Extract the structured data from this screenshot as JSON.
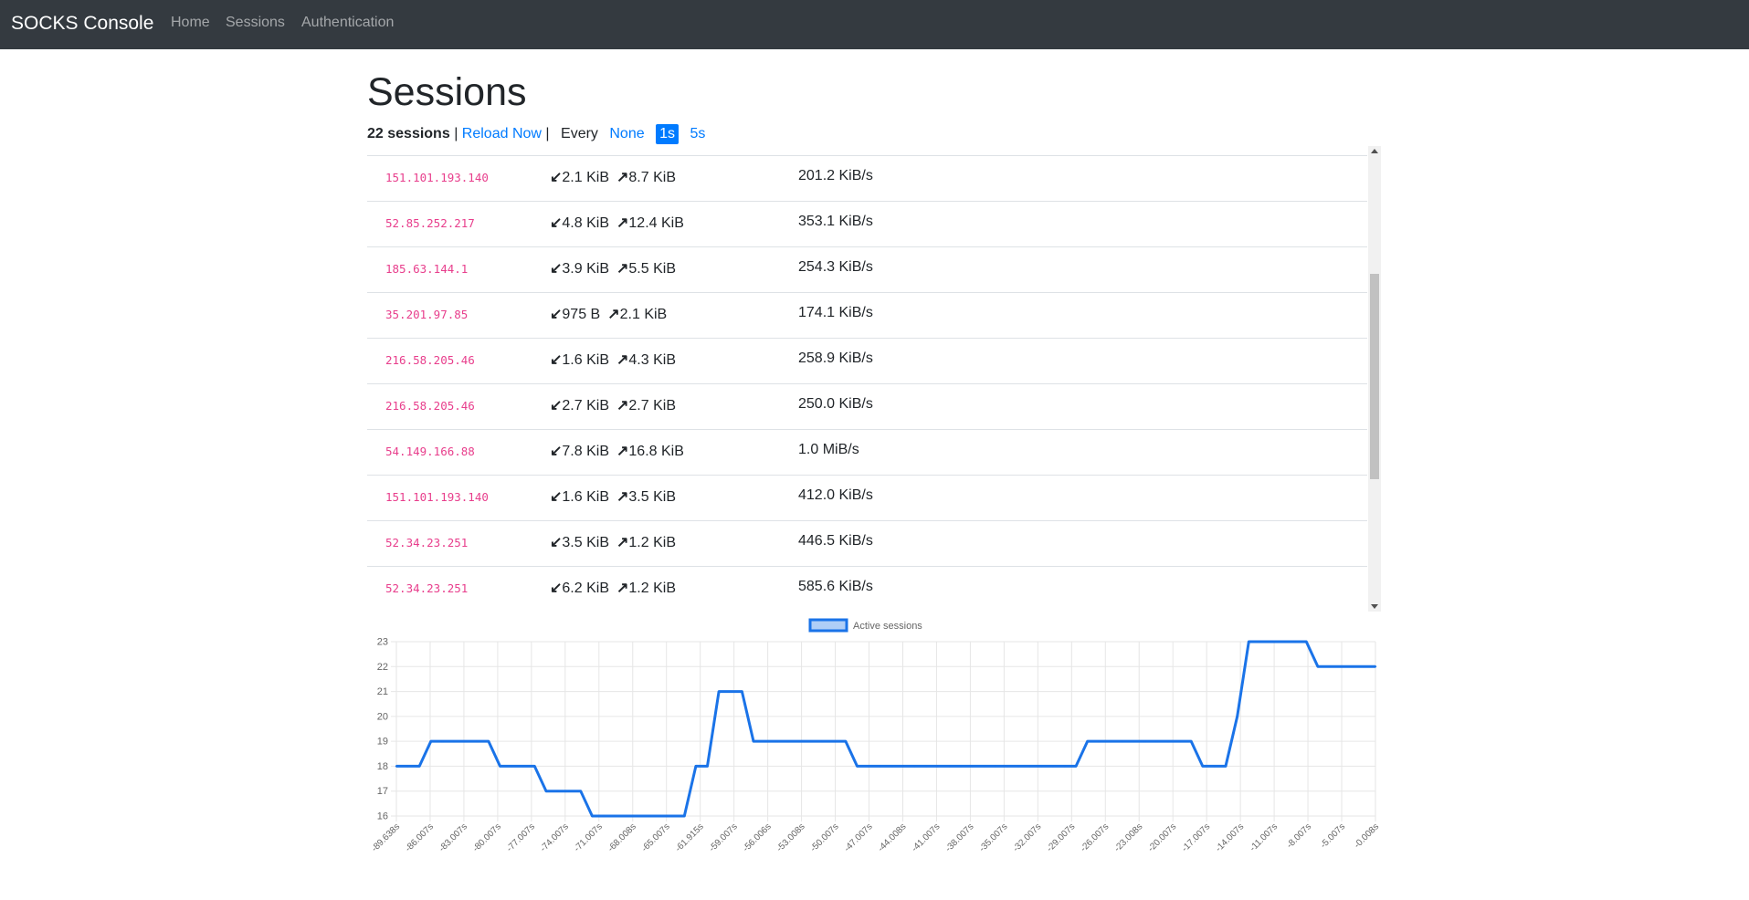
{
  "app": {
    "brand": "SOCKS Console",
    "nav": [
      "Home",
      "Sessions",
      "Authentication"
    ]
  },
  "page": {
    "title": "Sessions",
    "session_count": "22 sessions",
    "sep1": "|",
    "reload": "Reload Now",
    "sep2": "|",
    "every": "Every",
    "options": [
      "None",
      "1s",
      "5s"
    ],
    "selected_option": "1s"
  },
  "icons": {
    "download": "arrow-down-left-icon",
    "upload": "arrow-up-right-icon"
  },
  "colors": {
    "accent": "#007bff",
    "ip_text": "#e83e8c",
    "navbar": "#343a40",
    "series": "#1a73e8"
  },
  "sessions": [
    {
      "ip": "151.101.193.140",
      "down": "2.1 KiB",
      "up": "8.7 KiB",
      "rate": "201.2 KiB/s"
    },
    {
      "ip": "52.85.252.217",
      "down": "4.8 KiB",
      "up": "12.4 KiB",
      "rate": "353.1 KiB/s"
    },
    {
      "ip": "185.63.144.1",
      "down": "3.9 KiB",
      "up": "5.5 KiB",
      "rate": "254.3 KiB/s"
    },
    {
      "ip": "35.201.97.85",
      "down": "975 B",
      "up": "2.1 KiB",
      "rate": "174.1 KiB/s"
    },
    {
      "ip": "216.58.205.46",
      "down": "1.6 KiB",
      "up": "4.3 KiB",
      "rate": "258.9 KiB/s"
    },
    {
      "ip": "216.58.205.46",
      "down": "2.7 KiB",
      "up": "2.7 KiB",
      "rate": "250.0 KiB/s"
    },
    {
      "ip": "54.149.166.88",
      "down": "7.8 KiB",
      "up": "16.8 KiB",
      "rate": "1.0 MiB/s"
    },
    {
      "ip": "151.101.193.140",
      "down": "1.6 KiB",
      "up": "3.5 KiB",
      "rate": "412.0 KiB/s"
    },
    {
      "ip": "52.34.23.251",
      "down": "3.5 KiB",
      "up": "1.2 KiB",
      "rate": "446.5 KiB/s"
    },
    {
      "ip": "52.34.23.251",
      "down": "6.2 KiB",
      "up": "1.2 KiB",
      "rate": "585.6 KiB/s"
    }
  ],
  "chart_data": {
    "type": "line",
    "legend": [
      "Active sessions"
    ],
    "legend_position": "top-center",
    "grid": true,
    "ylim": [
      16,
      23
    ],
    "y_ticks": [
      16,
      17,
      18,
      19,
      20,
      21,
      22,
      23
    ],
    "x_tick_labels": [
      "-89.638s",
      "-86.007s",
      "-83.007s",
      "-80.007s",
      "-77.007s",
      "-74.007s",
      "-71.007s",
      "-68.008s",
      "-65.007s",
      "-61.915s",
      "-59.007s",
      "-56.006s",
      "-53.008s",
      "-50.007s",
      "-47.007s",
      "-44.008s",
      "-41.007s",
      "-38.007s",
      "-35.007s",
      "-32.007s",
      "-29.007s",
      "-26.007s",
      "-23.008s",
      "-20.007s",
      "-17.007s",
      "-14.007s",
      "-11.007s",
      "-8.007s",
      "-5.007s",
      "-0.008s"
    ],
    "series": [
      {
        "name": "Active sessions",
        "values": [
          18,
          18,
          18,
          19,
          19,
          19,
          19,
          19,
          19,
          18,
          18,
          18,
          18,
          17,
          17,
          17,
          17,
          16,
          16,
          16,
          16,
          16,
          16,
          16,
          16,
          16,
          18,
          18,
          21,
          21,
          21,
          19,
          19,
          19,
          19,
          19,
          19,
          19,
          19,
          19,
          18,
          18,
          18,
          18,
          18,
          18,
          18,
          18,
          18,
          18,
          18,
          18,
          18,
          18,
          18,
          18,
          18,
          18,
          18,
          18,
          19,
          19,
          19,
          19,
          19,
          19,
          19,
          19,
          19,
          19,
          18,
          18,
          18,
          20,
          23,
          23,
          23,
          23,
          23,
          23,
          22,
          22,
          22,
          22,
          22,
          22
        ]
      }
    ]
  }
}
